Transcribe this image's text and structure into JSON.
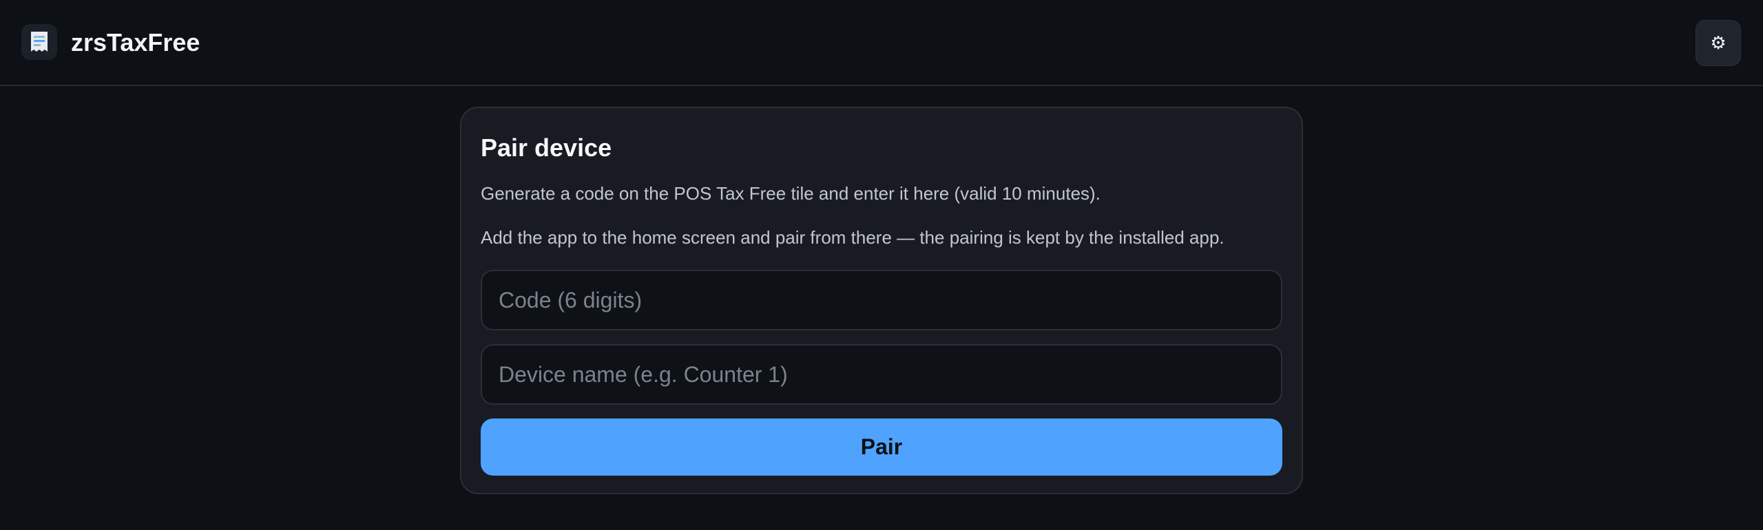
{
  "header": {
    "app_icon": "receipt-icon",
    "app_title": "zrsTaxFree",
    "settings_icon": "gear-icon",
    "settings_glyph": "⚙"
  },
  "pair_card": {
    "title": "Pair device",
    "description": "Generate a code on the POS Tax Free tile and enter it here (valid 10 minutes).",
    "hint": "Add the app to the home screen and pair from there — the pairing is kept by the installed app.",
    "code_field": {
      "placeholder": "Code (6 digits)",
      "value": ""
    },
    "device_name_field": {
      "placeholder": "Device name (e.g. Counter 1)",
      "value": ""
    },
    "pair_button_label": "Pair"
  },
  "colors": {
    "background": "#0d1014",
    "card": "#181b22",
    "accent": "#4fa3ff"
  }
}
